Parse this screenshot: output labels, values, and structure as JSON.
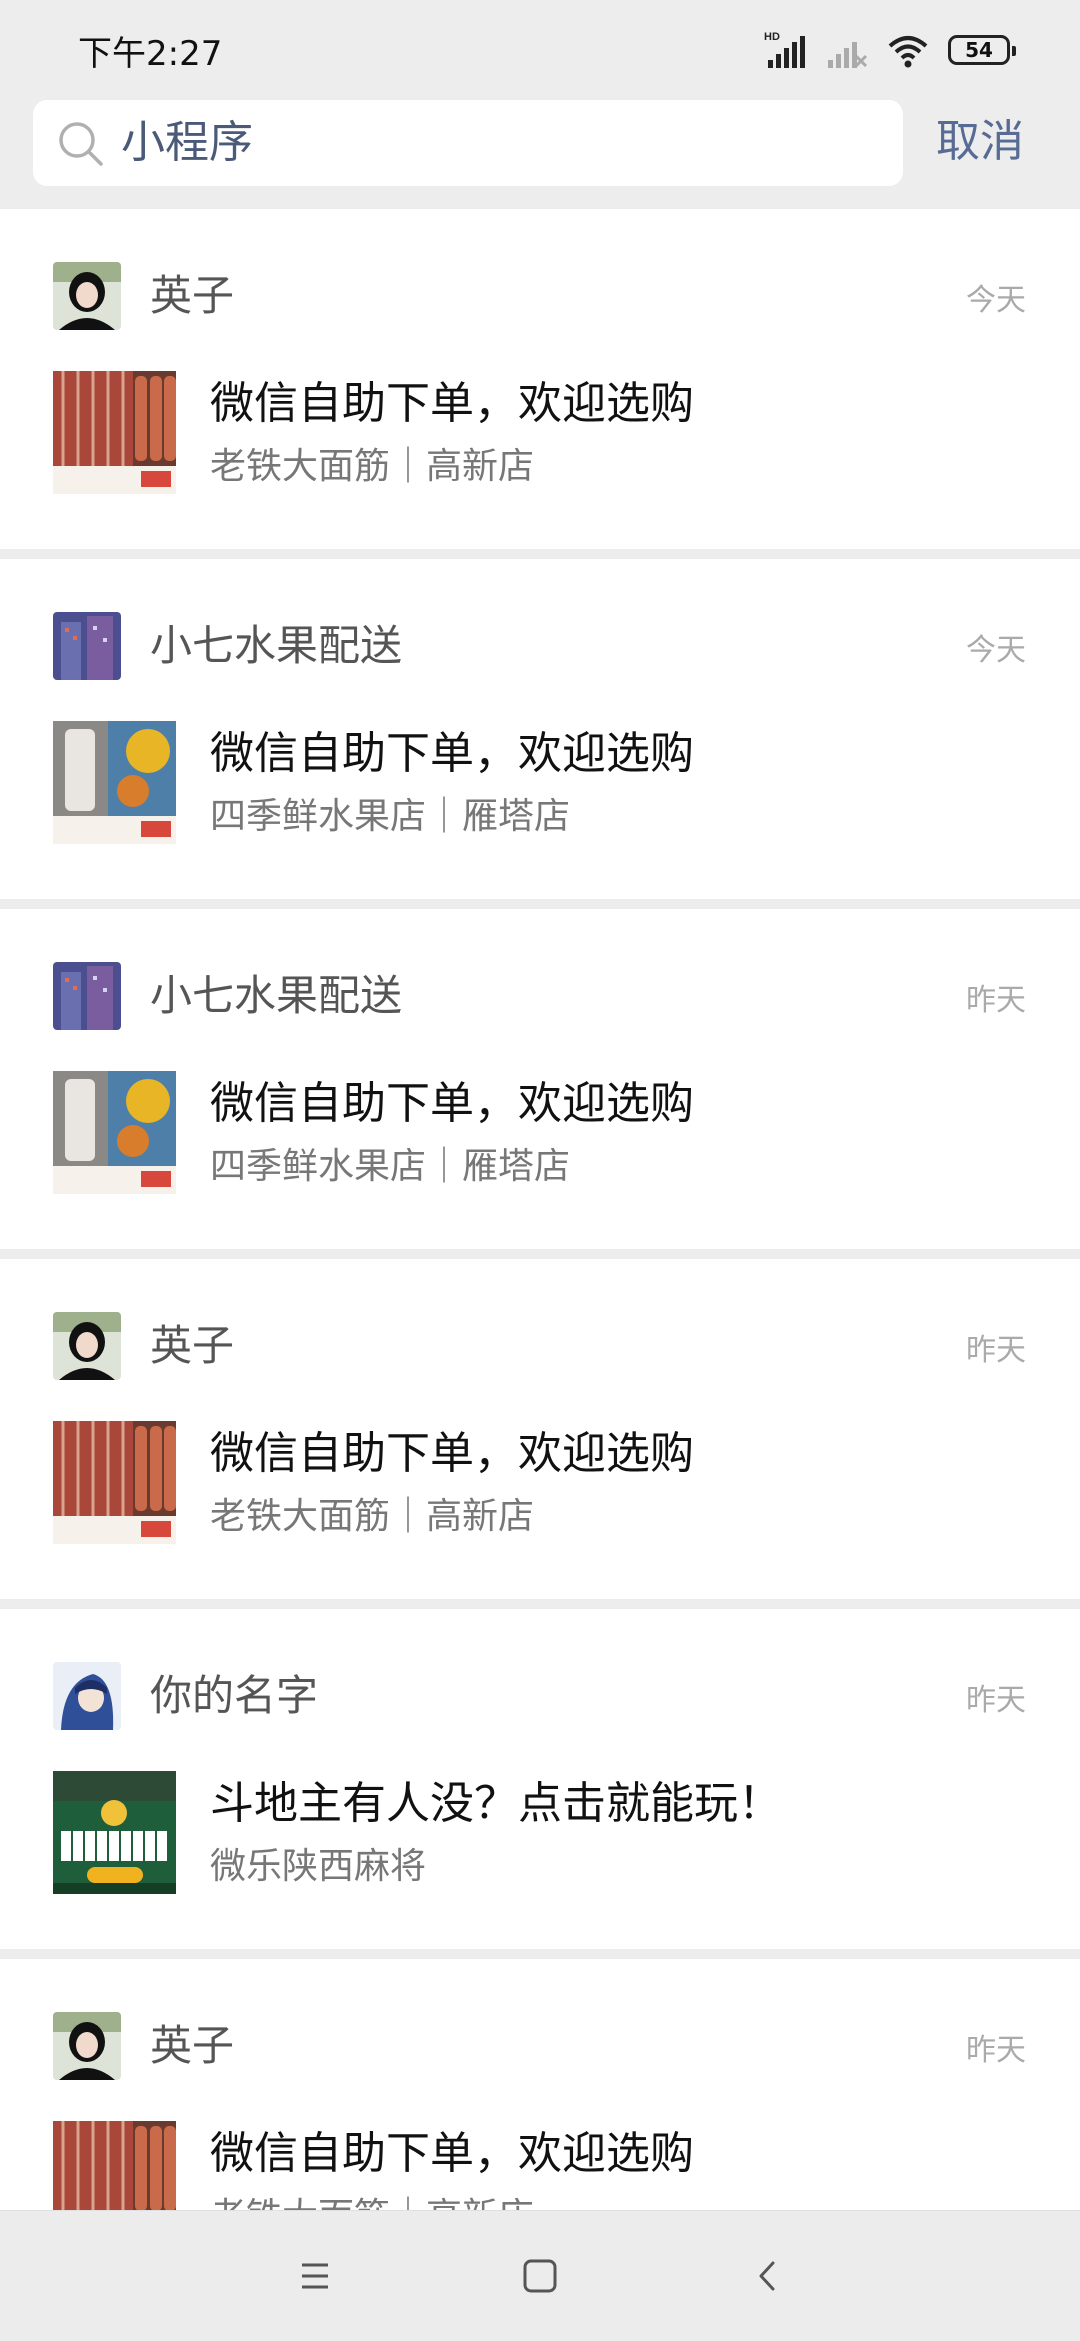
{
  "status_bar": {
    "time": "下午2:27",
    "battery": "54",
    "network_label": "HD"
  },
  "search": {
    "query": "小程序",
    "cancel_label": "取消"
  },
  "colors": {
    "link": "#576b95",
    "search_text": "#4a5a78"
  },
  "items": [
    {
      "sender": "英子",
      "time": "今天",
      "title": "微信自助下单，欢迎选购",
      "subtitle": "老铁大面筋｜高新店",
      "avatar": "girl-avatar",
      "thumb": "meat-skewers-thumb"
    },
    {
      "sender": "小七水果配送",
      "time": "今天",
      "title": "微信自助下单，欢迎选购",
      "subtitle": "四季鲜水果店｜雁塔店",
      "avatar": "building-avatar",
      "thumb": "fruit-thumb"
    },
    {
      "sender": "小七水果配送",
      "time": "昨天",
      "title": "微信自助下单，欢迎选购",
      "subtitle": "四季鲜水果店｜雁塔店",
      "avatar": "building-avatar",
      "thumb": "fruit-thumb"
    },
    {
      "sender": "英子",
      "time": "昨天",
      "title": "微信自助下单，欢迎选购",
      "subtitle": "老铁大面筋｜高新店",
      "avatar": "girl-avatar",
      "thumb": "meat-skewers-thumb"
    },
    {
      "sender": "你的名字",
      "time": "昨天",
      "title": "斗地主有人没？点击就能玩！",
      "subtitle": "微乐陕西麻将",
      "avatar": "anime-avatar",
      "thumb": "card-game-thumb"
    },
    {
      "sender": "英子",
      "time": "昨天",
      "title": "微信自助下单，欢迎选购",
      "subtitle": "老铁大面筋｜高新店",
      "avatar": "girl-avatar",
      "thumb": "meat-skewers-thumb"
    }
  ],
  "nav": {
    "menu_icon": "menu-icon",
    "home_icon": "home-icon",
    "back_icon": "back-icon"
  }
}
